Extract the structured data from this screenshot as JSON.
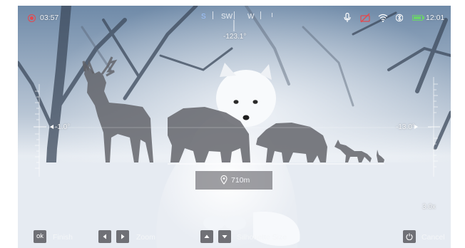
{
  "status_bar": {
    "recording_time": "03:57",
    "clock": "12:01",
    "icons": [
      "record-dot-icon",
      "microphone-icon",
      "camera-off-icon",
      "wifi-icon",
      "bluetooth-icon",
      "battery-icon"
    ]
  },
  "compass": {
    "marks": [
      "S",
      "SW",
      "W"
    ],
    "heading": "-123.1°",
    "sw_color": "#ffffff",
    "s_color": "#9ec3ff"
  },
  "inclinometer": {
    "left_reading": "-1.0°",
    "right_reading": "-13.0°"
  },
  "distance": {
    "value": "710m",
    "icon": "location-pin-icon"
  },
  "zoom_level": "3.0x",
  "silhouettes": [
    "deer-silhouette",
    "bear-silhouette",
    "boar-silhouette",
    "fox-silhouette",
    "rabbit-silhouette"
  ],
  "controls": {
    "ok_key": "ok",
    "finish_label": "Finish",
    "zoom_label": "Zoom",
    "silhouette_label": "Silhouette Size",
    "cancel_label": "Cancel",
    "icons": [
      "arrow-left-icon",
      "arrow-right-icon",
      "arrow-up-icon",
      "arrow-down-icon",
      "power-icon"
    ]
  },
  "colors": {
    "record": "#e5484d",
    "battery": "#6bd36b",
    "silhouette": "#5f6066"
  }
}
